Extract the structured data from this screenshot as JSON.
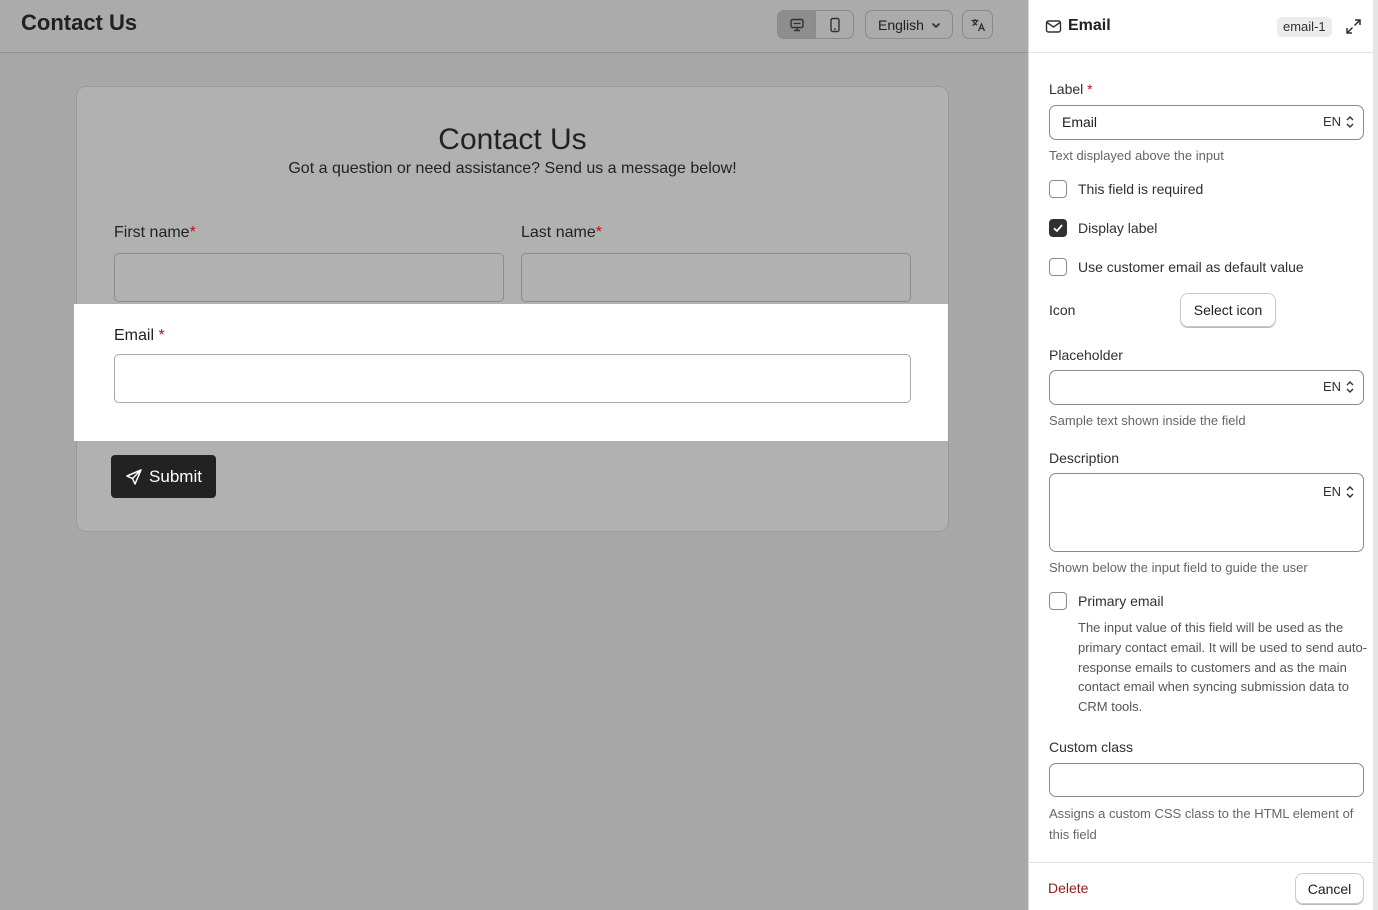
{
  "topbar": {
    "title": "Contact Us",
    "language": "English",
    "device_toggle": {
      "desktop_icon": "desktop-icon",
      "mobile_icon": "mobile-icon",
      "active": "desktop"
    },
    "translate_icon": "translate-icon"
  },
  "form": {
    "title": "Contact Us",
    "subtitle": "Got a question or need assistance? Send us a message below!",
    "fields": {
      "first_name": {
        "label": "First name",
        "required_mark": "*"
      },
      "last_name": {
        "label": "Last name",
        "required_mark": "*"
      },
      "email": {
        "label": "Email",
        "required_mark": "*"
      }
    },
    "submit": {
      "label": "Submit",
      "icon": "send-icon"
    }
  },
  "panel": {
    "header": {
      "title": "Email",
      "id_badge": "email-1",
      "icon": "envelope-icon",
      "expand_icon": "expand-icon"
    },
    "label_field": {
      "label": "Label",
      "required_mark": "*",
      "value": "Email",
      "lang": "EN",
      "help": "Text displayed above the input"
    },
    "checkboxes": {
      "required": {
        "label": "This field is required",
        "checked": false
      },
      "display_label": {
        "label": "Display label",
        "checked": true
      },
      "customer_email_default": {
        "label": "Use customer email as default value",
        "checked": false
      }
    },
    "icon_field": {
      "label": "Icon",
      "button": "Select icon"
    },
    "placeholder_field": {
      "label": "Placeholder",
      "value": "",
      "lang": "EN",
      "help": "Sample text shown inside the field"
    },
    "description_field": {
      "label": "Description",
      "value": "",
      "lang": "EN",
      "help": "Shown below the input field to guide the user"
    },
    "primary_email": {
      "label": "Primary email",
      "checked": false,
      "description": "The input value of this field will be used as the primary contact email. It will be used to send auto-response emails to customers and as the main contact email when syncing submission data to CRM tools."
    },
    "custom_class_field": {
      "label": "Custom class",
      "value": "",
      "help": "Assigns a custom CSS class to the HTML element of this field"
    },
    "footer": {
      "delete": "Delete",
      "cancel": "Cancel"
    }
  },
  "colors": {
    "required": "#b81414",
    "delete": "#8e1b1b",
    "submit_bg": "#222222",
    "overlay": "#a8a8a8"
  }
}
